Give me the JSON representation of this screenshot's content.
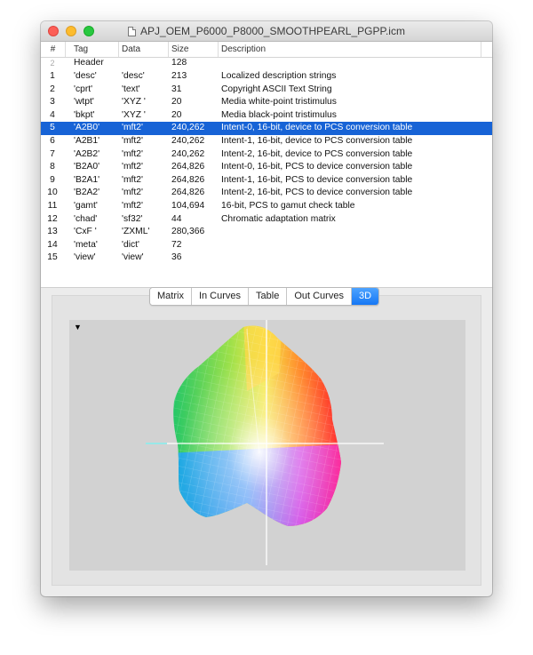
{
  "window": {
    "title": "APJ_OEM_P6000_P8000_SMOOTHPEARL_PGPP.icm"
  },
  "table": {
    "headers": {
      "num": "#",
      "tag": "Tag",
      "data": "Data",
      "size": "Size",
      "desc": "Description"
    },
    "header_row": {
      "num": "2",
      "tag": "Header",
      "size": "128"
    },
    "rows": [
      {
        "num": "1",
        "tag": "'desc'",
        "data": "'desc'",
        "size": "213",
        "desc": "Localized description strings"
      },
      {
        "num": "2",
        "tag": "'cprt'",
        "data": "'text'",
        "size": "31",
        "desc": "Copyright ASCII Text String"
      },
      {
        "num": "3",
        "tag": "'wtpt'",
        "data": "'XYZ '",
        "size": "20",
        "desc": "Media white-point tristimulus"
      },
      {
        "num": "4",
        "tag": "'bkpt'",
        "data": "'XYZ '",
        "size": "20",
        "desc": "Media black-point tristimulus"
      },
      {
        "num": "5",
        "tag": "'A2B0'",
        "data": "'mft2'",
        "size": "240,262",
        "desc": "Intent-0, 16-bit, device to PCS conversion table",
        "selected": true
      },
      {
        "num": "6",
        "tag": "'A2B1'",
        "data": "'mft2'",
        "size": "240,262",
        "desc": "Intent-1, 16-bit, device to PCS conversion table"
      },
      {
        "num": "7",
        "tag": "'A2B2'",
        "data": "'mft2'",
        "size": "240,262",
        "desc": "Intent-2, 16-bit, device to PCS conversion table"
      },
      {
        "num": "8",
        "tag": "'B2A0'",
        "data": "'mft2'",
        "size": "264,826",
        "desc": "Intent-0, 16-bit, PCS to device conversion table"
      },
      {
        "num": "9",
        "tag": "'B2A1'",
        "data": "'mft2'",
        "size": "264,826",
        "desc": "Intent-1, 16-bit, PCS to device conversion table"
      },
      {
        "num": "10",
        "tag": "'B2A2'",
        "data": "'mft2'",
        "size": "264,826",
        "desc": "Intent-2, 16-bit, PCS to device conversion table"
      },
      {
        "num": "11",
        "tag": "'gamt'",
        "data": "'mft2'",
        "size": "104,694",
        "desc": "16-bit, PCS to gamut check table"
      },
      {
        "num": "12",
        "tag": "'chad'",
        "data": "'sf32'",
        "size": "44",
        "desc": "Chromatic adaptation matrix"
      },
      {
        "num": "13",
        "tag": "'CxF '",
        "data": "'ZXML'",
        "size": "280,366",
        "desc": ""
      },
      {
        "num": "14",
        "tag": "'meta'",
        "data": "'dict'",
        "size": "72",
        "desc": ""
      },
      {
        "num": "15",
        "tag": "'view'",
        "data": "'view'",
        "size": "36",
        "desc": ""
      }
    ]
  },
  "tabs": {
    "items": [
      "Matrix",
      "In Curves",
      "Table",
      "Out Curves",
      "3D"
    ],
    "selected": "3D"
  },
  "view3d": {
    "menu_icon": "disclosure-triangle-icon",
    "menu_glyph": "▼"
  },
  "colors": {
    "selection": "#1763d6",
    "accent": "#1677f4"
  }
}
